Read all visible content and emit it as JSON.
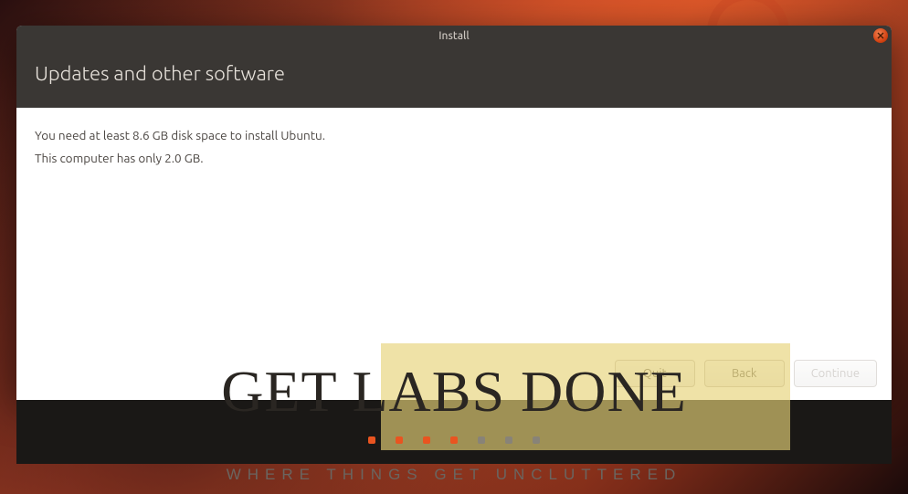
{
  "window": {
    "title": "Install"
  },
  "header": {
    "title": "Updates and other software"
  },
  "content": {
    "line1": "You need at least 8.6 GB disk space to install Ubuntu.",
    "line2": "This computer has only 2.0 GB."
  },
  "buttons": {
    "quit": "Quit",
    "back": "Back",
    "continue": "Continue"
  },
  "watermark": {
    "title": "GET LABS DONE",
    "subtitle": "WHERE THINGS GET UNCLUTTERED"
  },
  "pager": {
    "total": 7,
    "active_count": 4
  }
}
